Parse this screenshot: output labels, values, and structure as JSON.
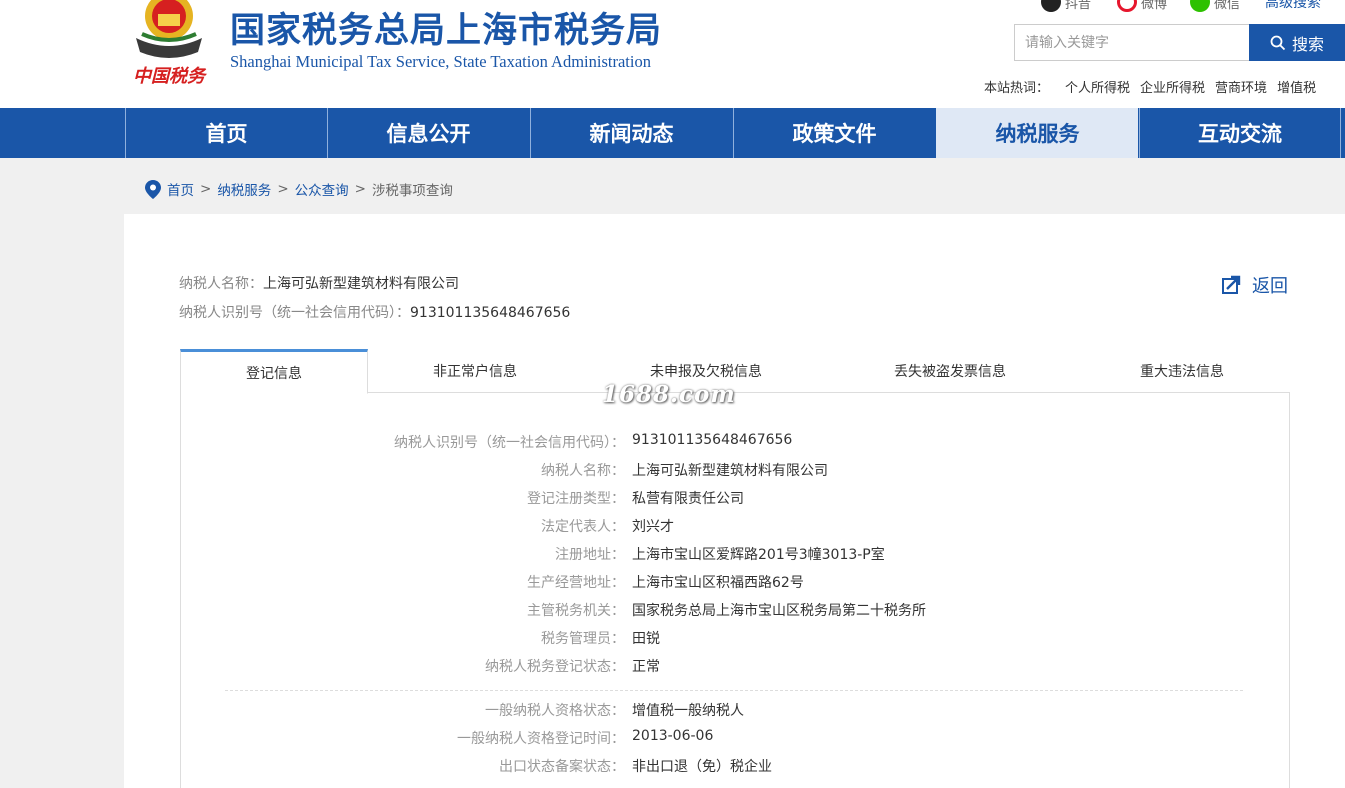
{
  "header": {
    "title": "国家税务总局上海市税务局",
    "subtitle": "Shanghai Municipal Tax Service, State Taxation Administration",
    "emblem_text": "中国税务",
    "social": [
      {
        "label": "抖音",
        "icon": "douyin-icon"
      },
      {
        "label": "微博",
        "icon": "weibo-icon"
      },
      {
        "label": "微信",
        "icon": "wechat-icon"
      }
    ],
    "advanced_search": "高级搜索",
    "search": {
      "placeholder": "请输入关键字",
      "button": "搜索"
    },
    "hotwords": {
      "label": "本站热词：",
      "items": [
        "个人所得税",
        "企业所得税",
        "营商环境",
        "增值税"
      ]
    }
  },
  "nav": [
    "首页",
    "信息公开",
    "新闻动态",
    "政策文件",
    "纳税服务",
    "互动交流"
  ],
  "breadcrumb": {
    "items": [
      "首页",
      "纳税服务",
      "公众查询"
    ],
    "current": "涉税事项查询",
    "sep": ">"
  },
  "taxpayer": {
    "name_label": "纳税人名称：",
    "name": "上海可弘新型建筑材料有限公司",
    "id_label": "纳税人识别号（统一社会信用代码）：",
    "id": "913101135648467656"
  },
  "back_label": "返回",
  "tabs": [
    "登记信息",
    "非正常户信息",
    "未申报及欠税信息",
    "丢失被盗发票信息",
    "重大违法信息"
  ],
  "watermark": "1688.com",
  "details": [
    {
      "k": "纳税人识别号（统一社会信用代码）：",
      "v": "913101135648467656"
    },
    {
      "k": "纳税人名称：",
      "v": "上海可弘新型建筑材料有限公司"
    },
    {
      "k": "登记注册类型：",
      "v": "私营有限责任公司"
    },
    {
      "k": "法定代表人：",
      "v": "刘兴才"
    },
    {
      "k": "注册地址：",
      "v": "上海市宝山区爱辉路201号3幢3013-P室"
    },
    {
      "k": "生产经营地址：",
      "v": "上海市宝山区积福西路62号"
    },
    {
      "k": "主管税务机关：",
      "v": "国家税务总局上海市宝山区税务局第二十税务所"
    },
    {
      "k": "税务管理员：",
      "v": "田锐"
    },
    {
      "k": "纳税人税务登记状态：",
      "v": "正常"
    }
  ],
  "details2": [
    {
      "k": "一般纳税人资格状态：",
      "v": "增值税一般纳税人"
    },
    {
      "k": "一般纳税人资格登记时间：",
      "v": "2013-06-06"
    },
    {
      "k": "出口状态备案状态：",
      "v": "非出口退（免）税企业"
    }
  ],
  "colors": {
    "brand": "#1a56a8",
    "nav_active_bg": "#dfe8f5",
    "tab_active_accent": "#4a8fd8"
  }
}
